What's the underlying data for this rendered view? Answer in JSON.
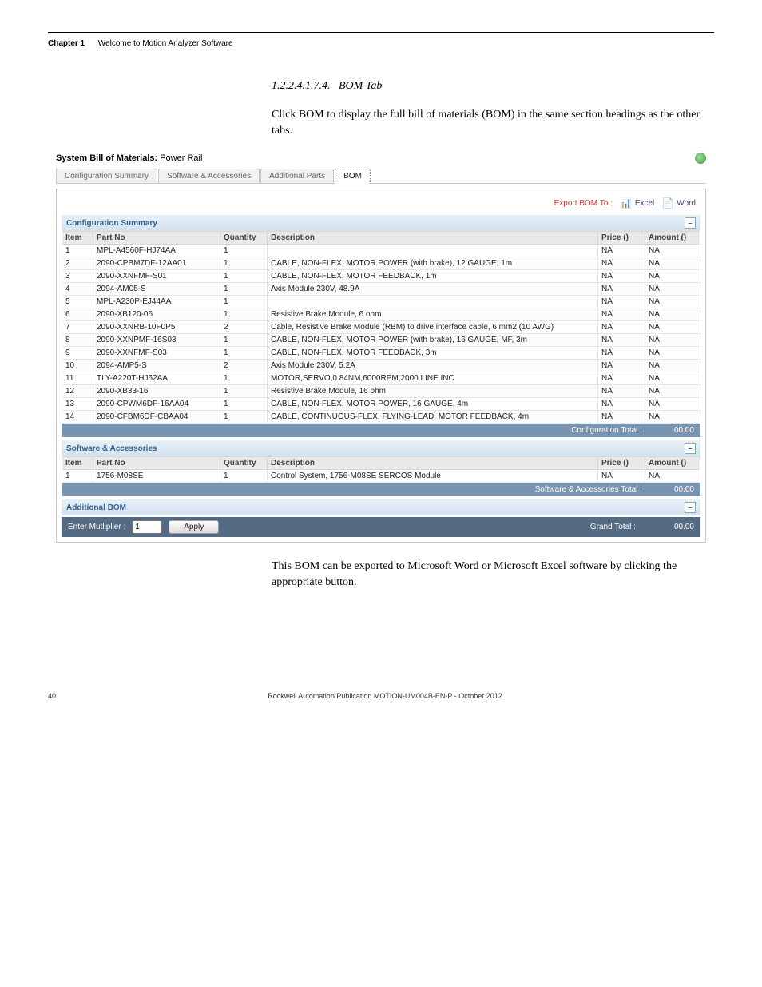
{
  "header": {
    "chapter": "Chapter 1",
    "chapter_title": "Welcome to Motion Analyzer Software"
  },
  "section": {
    "number": "1.2.2.4.1.7.4.",
    "title": "BOM Tab"
  },
  "text": {
    "intro": "Click BOM to display the full bill of materials (BOM) in the same section headings as the other tabs.",
    "outro": "This BOM can be exported to Microsoft Word or Microsoft Excel software by clicking the appropriate button."
  },
  "panel": {
    "title_prefix": "System Bill of Materials:",
    "title_suffix": "Power Rail",
    "tabs": [
      "Configuration Summary",
      "Software & Accessories",
      "Additional Parts",
      "BOM"
    ],
    "active_tab": "BOM",
    "export_label": "Export BOM To :",
    "excel_label": "Excel",
    "word_label": "Word"
  },
  "config_section": {
    "title": "Configuration Summary",
    "cols": [
      "Item",
      "Part No",
      "Quantity",
      "Description",
      "Price ()",
      "Amount ()"
    ],
    "rows": [
      {
        "i": "1",
        "pn": "MPL-A4560F-HJ74AA",
        "q": "1",
        "d": "",
        "p": "NA",
        "a": "NA"
      },
      {
        "i": "2",
        "pn": "2090-CPBM7DF-12AA01",
        "q": "1",
        "d": "CABLE, NON-FLEX,  MOTOR POWER (with brake), 12 GAUGE, 1m",
        "p": "NA",
        "a": "NA"
      },
      {
        "i": "3",
        "pn": "2090-XXNFMF-S01",
        "q": "1",
        "d": "CABLE, NON-FLEX, MOTOR FEEDBACK, 1m",
        "p": "NA",
        "a": "NA"
      },
      {
        "i": "4",
        "pn": "2094-AM05-S",
        "q": "1",
        "d": "Axis Module 230V, 48.9A",
        "p": "NA",
        "a": "NA"
      },
      {
        "i": "5",
        "pn": "MPL-A230P-EJ44AA",
        "q": "1",
        "d": "",
        "p": "NA",
        "a": "NA"
      },
      {
        "i": "6",
        "pn": "2090-XB120-06",
        "q": "1",
        "d": "Resistive Brake Module, 6 ohm",
        "p": "NA",
        "a": "NA"
      },
      {
        "i": "7",
        "pn": "2090-XXNRB-10F0P5",
        "q": "2",
        "d": "Cable, Resistive Brake Module (RBM) to drive interface cable, 6 mm2 (10 AWG)",
        "p": "NA",
        "a": "NA"
      },
      {
        "i": "8",
        "pn": "2090-XXNPMF-16S03",
        "q": "1",
        "d": "CABLE, NON-FLEX,  MOTOR POWER (with brake), 16 GAUGE, MF, 3m",
        "p": "NA",
        "a": "NA"
      },
      {
        "i": "9",
        "pn": "2090-XXNFMF-S03",
        "q": "1",
        "d": "CABLE, NON-FLEX, MOTOR FEEDBACK, 3m",
        "p": "NA",
        "a": "NA"
      },
      {
        "i": "10",
        "pn": "2094-AMP5-S",
        "q": "2",
        "d": "Axis Module 230V, 5.2A",
        "p": "NA",
        "a": "NA"
      },
      {
        "i": "11",
        "pn": "TLY-A220T-HJ62AA",
        "q": "1",
        "d": "MOTOR,SERVO,0.84NM,6000RPM,2000 LINE INC",
        "p": "NA",
        "a": "NA"
      },
      {
        "i": "12",
        "pn": "2090-XB33-16",
        "q": "1",
        "d": "Resistive Brake Module, 16 ohm",
        "p": "NA",
        "a": "NA"
      },
      {
        "i": "13",
        "pn": "2090-CPWM6DF-16AA04",
        "q": "1",
        "d": "CABLE, NON-FLEX, MOTOR POWER, 16 GAUGE, 4m",
        "p": "NA",
        "a": "NA"
      },
      {
        "i": "14",
        "pn": "2090-CFBM6DF-CBAA04",
        "q": "1",
        "d": "CABLE, CONTINUOUS-FLEX, FLYING-LEAD, MOTOR FEEDBACK, 4m",
        "p": "NA",
        "a": "NA"
      }
    ],
    "total_label": "Configuration Total :",
    "total_value": "00.00"
  },
  "sw_section": {
    "title": "Software & Accessories",
    "cols": [
      "Item",
      "Part No",
      "Quantity",
      "Description",
      "Price ()",
      "Amount ()"
    ],
    "rows": [
      {
        "i": "1",
        "pn": "1756-M08SE",
        "q": "1",
        "d": "Control System, 1756-M08SE SERCOS Module",
        "p": "NA",
        "a": "NA"
      }
    ],
    "total_label": "Software & Accessories Total :",
    "total_value": "00.00"
  },
  "add_section": {
    "title": "Additional BOM"
  },
  "bottom": {
    "multiplier_label": "Enter Mutliplier :",
    "multiplier_value": "1",
    "apply_label": "Apply",
    "grand_label": "Grand Total :",
    "grand_value": "00.00"
  },
  "footer": {
    "page": "40",
    "pub": "Rockwell Automation Publication MOTION-UM004B-EN-P - October 2012"
  }
}
